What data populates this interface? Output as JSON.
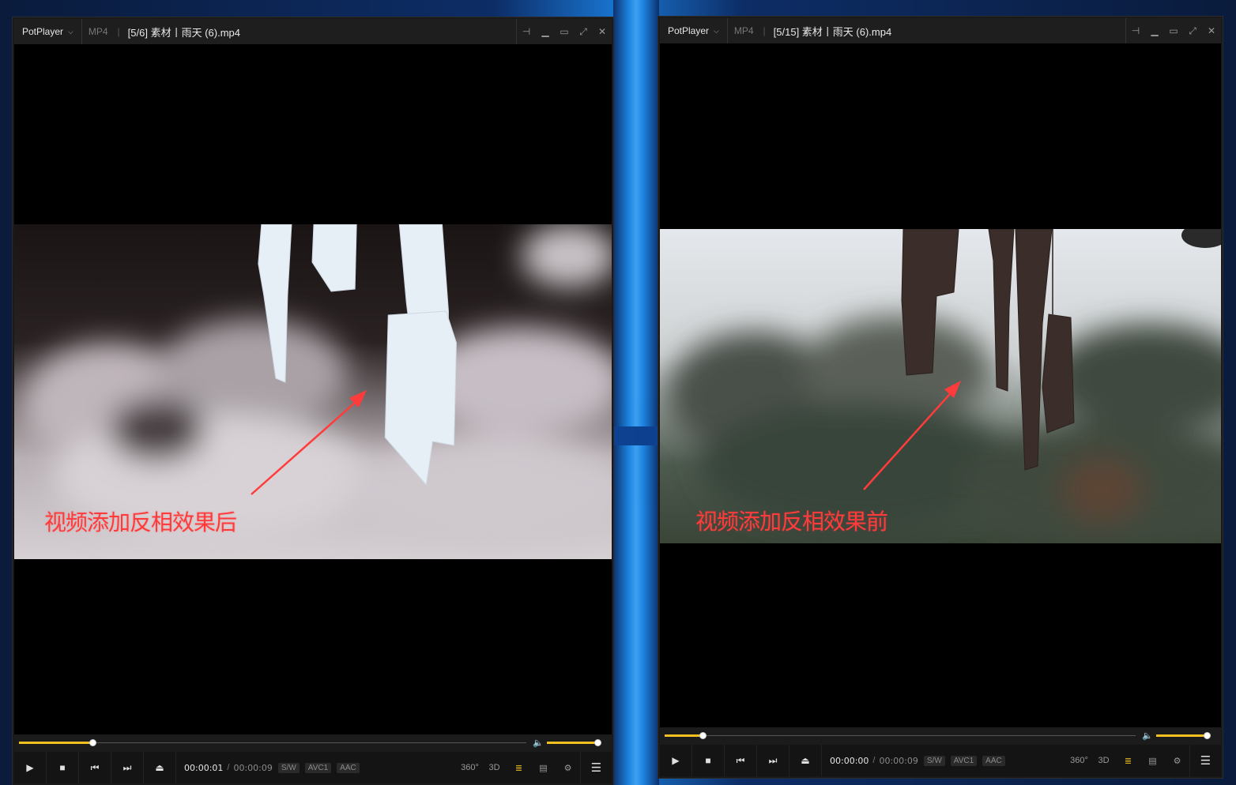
{
  "colors": {
    "accent": "#f0c020",
    "annotation": "#ff3b3b",
    "titlebar": "#1e1e1e"
  },
  "left": {
    "brand": "PotPlayer",
    "format": "MP4",
    "file_title": "[5/6] 素材丨雨天 (6).mp4",
    "caption": "视频添加反相效果后",
    "time_current": "00:00:01",
    "time_sep": "/",
    "time_total": "00:00:09",
    "tags": [
      "S/W",
      "AVC1",
      "AAC"
    ],
    "seek_fraction": 0.145,
    "volume_fraction": 1.0
  },
  "right": {
    "brand": "PotPlayer",
    "format": "MP4",
    "file_title": "[5/15] 素材丨雨天 (6).mp4",
    "caption": "视频添加反相效果前",
    "time_current": "00:00:00",
    "time_sep": "/",
    "time_total": "00:00:09",
    "tags": [
      "S/W",
      "AVC1",
      "AAC"
    ],
    "seek_fraction": 0.08,
    "volume_fraction": 1.0
  },
  "icons": {
    "pin": "pin-icon",
    "minimize": "minimize-icon",
    "maximize": "maximize-icon",
    "fullscreen": "fullscreen-icon",
    "close": "close-icon",
    "play": "play-icon",
    "stop": "stop-icon",
    "prev": "previous-icon",
    "next": "next-icon",
    "eject": "eject-icon",
    "vr360": "360-icon",
    "3d": "3d-icon",
    "playlist": "playlist-search-icon",
    "subtitle": "subtitle-icon",
    "settings": "gear-icon",
    "menu": "hamburger-menu-icon",
    "volume": "speaker-icon"
  },
  "tool_labels": {
    "vr360": "360°",
    "three_d": "3D"
  }
}
